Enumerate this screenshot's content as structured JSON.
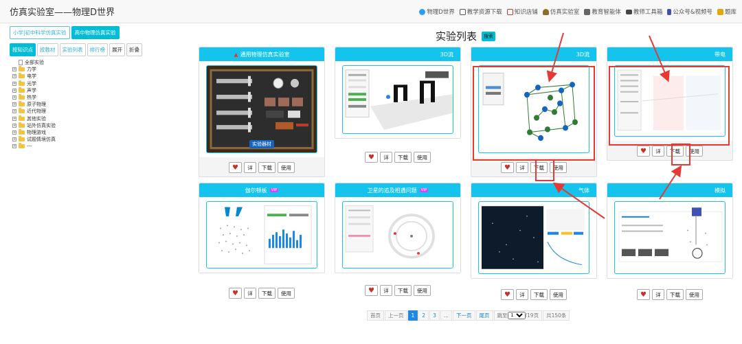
{
  "navbar": {
    "brand": "仿真实验室——物理D世界",
    "items": [
      {
        "label": "物理D世界",
        "icon": "globe-icon",
        "color": "#2a9df4"
      },
      {
        "label": "教学资源下载",
        "icon": "screen-icon",
        "color": "#555555"
      },
      {
        "label": "知识店铺",
        "icon": "shop-icon",
        "color": "#c0392b"
      },
      {
        "label": "仿真实验室",
        "icon": "flask-icon",
        "color": "#8e6e2e"
      },
      {
        "label": "教育智能体",
        "icon": "robot-icon",
        "color": "#555555"
      },
      {
        "label": "教师工具箱",
        "icon": "toolbox-icon",
        "color": "#555555"
      },
      {
        "label": "公众号&视频号",
        "icon": "phone-icon",
        "color": "#3f51b5"
      },
      {
        "label": "题库",
        "icon": "pencil-icon",
        "color": "#e6a700"
      }
    ]
  },
  "sidebar": {
    "grade_tabs": [
      {
        "label": "小学|初中科学仿真实验",
        "active": false
      },
      {
        "label": "高中物理仿真实验",
        "active": true
      }
    ],
    "filters": [
      {
        "label": "按知识点",
        "active": true
      },
      {
        "label": "按教材",
        "active": false
      },
      {
        "label": "实验列表",
        "active": false
      },
      {
        "label": "排行榜",
        "active": false
      },
      {
        "label": "展开",
        "active": false,
        "plain": true
      },
      {
        "label": "折叠",
        "active": false,
        "plain": true
      }
    ],
    "tree": [
      {
        "label": "全部实验",
        "type": "file"
      },
      {
        "label": "力学",
        "type": "folder"
      },
      {
        "label": "电学",
        "type": "folder"
      },
      {
        "label": "光学",
        "type": "folder"
      },
      {
        "label": "声学",
        "type": "folder"
      },
      {
        "label": "热学",
        "type": "folder"
      },
      {
        "label": "原子物理",
        "type": "folder"
      },
      {
        "label": "近代物理",
        "type": "folder"
      },
      {
        "label": "其他实验",
        "type": "folder"
      },
      {
        "label": "站外仿真实验",
        "type": "folder"
      },
      {
        "label": "物理游戏",
        "type": "folder"
      },
      {
        "label": "试题情境仿真",
        "type": "folder"
      },
      {
        "label": "---",
        "type": "folder"
      }
    ]
  },
  "main": {
    "title": "实验列表",
    "search_label": "搜索",
    "thumb_badge": "实验器材",
    "cards": [
      {
        "title": "通用物理仿真实验室",
        "vip": false,
        "pinned": true
      },
      {
        "title": "3D流",
        "vip": false,
        "pinned": false
      },
      {
        "title": "3D流",
        "vip": false,
        "pinned": false
      },
      {
        "title": "带电",
        "vip": false,
        "pinned": false
      },
      {
        "title": "伽尔顿板",
        "vip": true,
        "pinned": false
      },
      {
        "title": "卫星的追及相遇问题",
        "vip": true,
        "pinned": false
      },
      {
        "title": "气体",
        "vip": false,
        "pinned": false
      },
      {
        "title": "模拟",
        "vip": false,
        "pinned": false
      }
    ],
    "vip_label": "VIP",
    "actions": {
      "detail": "详",
      "download": "下载",
      "use": "使用"
    }
  },
  "pagination": {
    "first": "首页",
    "prev": "上一页",
    "pages": [
      "1",
      "2",
      "3"
    ],
    "ellipsis": "...",
    "next": "下一页",
    "last": "尾页",
    "jump_prefix": "跳至",
    "jump_value": "1",
    "jump_suffix": "/19页",
    "total": "共150条"
  },
  "colors": {
    "accent": "#14c4ec",
    "annotation": "#e53935",
    "page_active": "#1e88e5"
  }
}
